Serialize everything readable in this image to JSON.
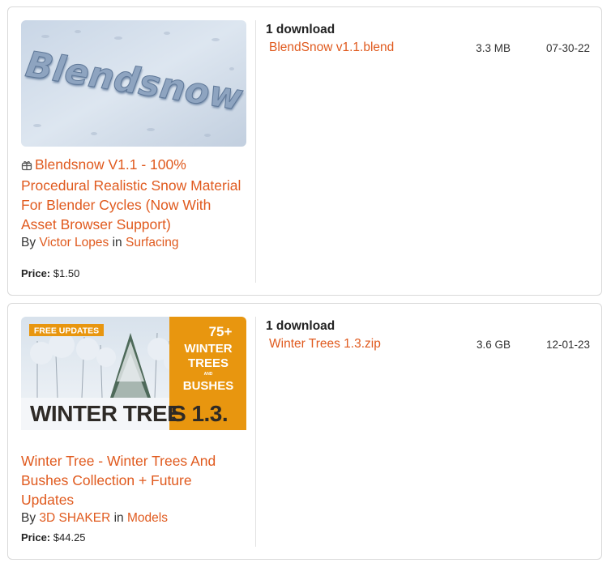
{
  "products": [
    {
      "title": "Blendsnow V1.1 - 100% Procedural Realistic Snow Material For Blender Cycles (Now With Asset Browser Support)",
      "by_label": "By",
      "in_label": "in",
      "author": "Victor Lopes",
      "category": "Surfacing",
      "price_label": "Price:",
      "price": "$1.50",
      "downloads_label": "1 download",
      "thumb_icon": "blendsnow-thumbnail",
      "thumb_text": "Blendsnow",
      "files": [
        {
          "name": "BlendSnow v1.1.blend",
          "size": "3.3 MB",
          "date": "07-30-22"
        }
      ],
      "has_gift_icon": true
    },
    {
      "title": "Winter Tree - Winter Trees And Bushes Collection + Future Updates",
      "by_label": "By",
      "in_label": "in",
      "author": "3D SHAKER",
      "category": "Models",
      "price_label": "Price:",
      "price": "$44.25",
      "downloads_label": "1 download",
      "thumb_icon": "winter-trees-thumbnail",
      "thumb_badge": "FREE UPDATES",
      "thumb_count": "75+",
      "thumb_line1": "WINTER",
      "thumb_line2": "TREES",
      "thumb_and": "AND",
      "thumb_line3": "BUSHES",
      "thumb_title_a": "WINTER TREE",
      "thumb_title_b": "S 1.3.",
      "files": [
        {
          "name": "Winter Trees 1.3.zip",
          "size": "3.6 GB",
          "date": "12-01-23"
        }
      ],
      "has_gift_icon": false
    }
  ],
  "colors": {
    "accent": "#e05a1e",
    "orange_panel": "#e8960f"
  }
}
